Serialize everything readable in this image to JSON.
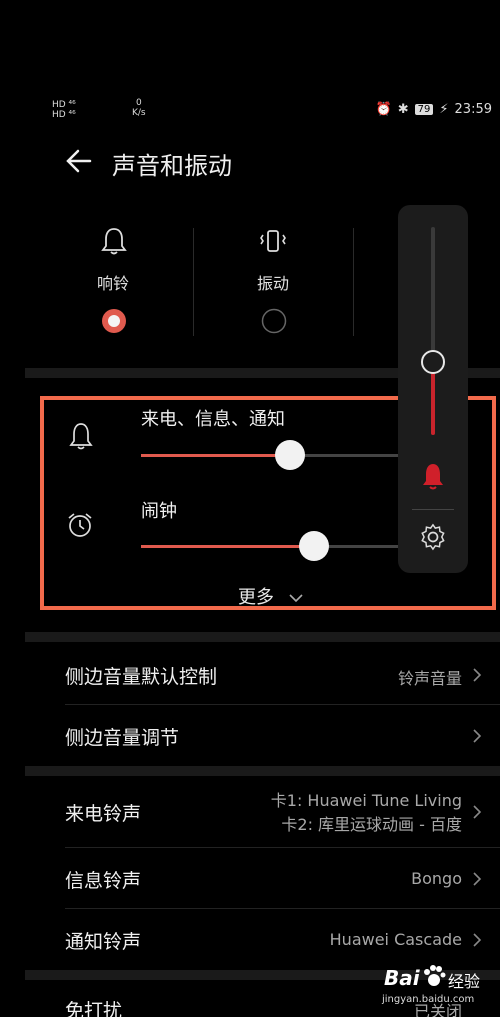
{
  "status_bar": {
    "signal_left_1": "HD ⁴⁶",
    "signal_left_2": "HD ⁴⁶",
    "net_speed": "0",
    "net_unit": "K/s",
    "battery": "79",
    "time": "23:59"
  },
  "header": {
    "title": "声音和振动"
  },
  "modes": [
    {
      "label": "响铃",
      "icon": "bell-icon",
      "selected": true
    },
    {
      "label": "振动",
      "icon": "vibrate-icon",
      "selected": false
    }
  ],
  "sliders": [
    {
      "label": "来电、信息、通知",
      "icon": "bell-icon",
      "level": 0.57
    },
    {
      "label": "闹钟",
      "icon": "alarm-clock-icon",
      "level": 0.66
    }
  ],
  "more_label": "更多",
  "volume_panel": {
    "level": 0.35,
    "icon_ring": "bell-icon",
    "icon_settings": "gear-icon"
  },
  "settings_group1": [
    {
      "label": "侧边音量默认控制",
      "value": "铃声音量"
    },
    {
      "label": "侧边音量调节",
      "value": ""
    }
  ],
  "settings_group2": [
    {
      "label": "来电铃声",
      "value_line1": "卡1: Huawei Tune Living",
      "value_line2": "卡2: 库里运球动画 - 百度"
    },
    {
      "label": "信息铃声",
      "value": "Bongo"
    },
    {
      "label": "通知铃声",
      "value": "Huawei Cascade"
    }
  ],
  "settings_group3": [
    {
      "label": "免打扰",
      "value": "已关闭"
    }
  ],
  "watermark": {
    "brand": "Bai",
    "brand2": "经验",
    "url": "jingyan.baidu.com"
  },
  "colors": {
    "accent": "#e05a4e",
    "highlight": "#f26a4b",
    "panel": "#1c1c1c"
  }
}
